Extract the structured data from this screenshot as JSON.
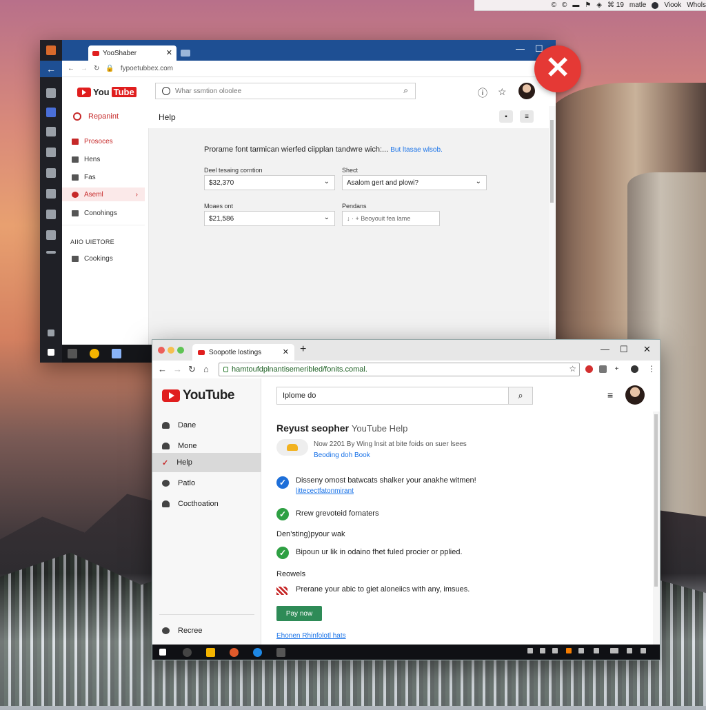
{
  "system_bar": {
    "items": [
      "©",
      "©",
      "▬",
      "⚑",
      "◈",
      "⌘ 19",
      "matle",
      "Viook",
      "Whols"
    ]
  },
  "back_window": {
    "tab_title": "YooShaber",
    "url": "fypoetubbex.com",
    "search_placeholder": "Whar ssmtion oloolee",
    "brand_label": "Repanint",
    "help_title": "Help",
    "sidebar": [
      {
        "label": "Prosoces"
      },
      {
        "label": "Hens"
      },
      {
        "label": "Fas"
      },
      {
        "label": "Aseml"
      },
      {
        "label": "Conohings"
      }
    ],
    "section_label": "AIIO UIETORE",
    "section_item": "Cookings",
    "question": "Prorame font tarmican wierfed ciipplan tandwre wich:...",
    "question_link": "But ltasae wlsob.",
    "fields": {
      "f1_label": "Deel tesaing corntion",
      "f1_value": "$32,370",
      "f2_label": "Shect",
      "f2_value": "Asalom gert and plowi?",
      "f3_label": "Moaes ont",
      "f3_value": "$21,586",
      "f4_label": "Pendans",
      "f4_value": "↓ · + Beoyouit fea lame"
    },
    "close_symbol": "✕"
  },
  "front_window": {
    "tab_title": "Soopotle lostings",
    "url": "hamtoufdplnantisemeribled/fonits.comal.",
    "logo_text": "YouTube",
    "sidebar": [
      {
        "label": "Dane"
      },
      {
        "label": "Mone"
      },
      {
        "label": "Help"
      },
      {
        "label": "Patlo"
      },
      {
        "label": "Cocthoation"
      }
    ],
    "sidebar_bottom": "Recree",
    "search_value": "Iplome do",
    "heading_bold": "Reyust seopher",
    "heading_rest": "YouTube Help",
    "notice_line1": "Now 2201 By Wing lnsit at bite foids on suer lsees",
    "notice_line2": "Beoding doh Book",
    "items": [
      {
        "text": "Disseny omost batwcats shalker your anakhe witmen!",
        "link": "littecectfatonmirant"
      },
      {
        "text": "Rrew grevoteid fornaters"
      }
    ],
    "section1": "Den’sting)pyour wak",
    "item3": "Bipoun ur lik in odaino fhet fuled procier or pplied.",
    "section2": "Reowels",
    "item4": "Prerane your abic to giet aloneiics with any, imsues.",
    "pay_button": "Pay now",
    "footer_link": "Ehonen Rhinfolotl hats"
  },
  "colors": {
    "accent_red": "#e53935",
    "youtube_red": "#e01e1e",
    "link_blue": "#1a73e8",
    "check_blue": "#1e6fd9",
    "check_green": "#2ea043",
    "pay_green": "#2e8b57"
  }
}
